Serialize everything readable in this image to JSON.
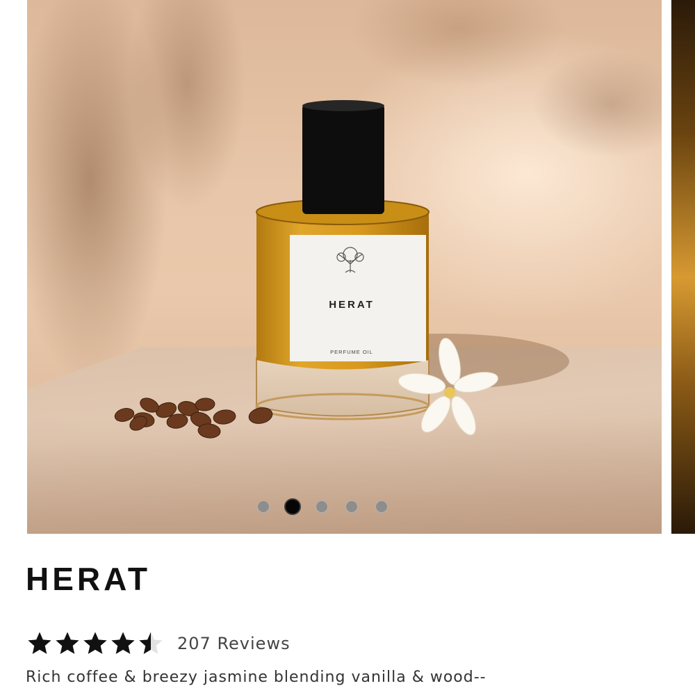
{
  "product": {
    "title": "HERAT",
    "rating_value": 4.5,
    "rating_max": 5,
    "reviews_label": "207 Reviews",
    "description": "Rich coffee & breezy jasmine blending vanilla & wood--"
  },
  "image": {
    "label_name": "HERAT",
    "label_subtitle": "PERFUME OIL",
    "icon": "tree-logo-icon"
  },
  "carousel": {
    "slide_count": 5,
    "active_index": 1
  },
  "colors": {
    "dot_active": "#050505",
    "dot_inactive": "#8d8d8d",
    "perfume_oil": "#d39a1f"
  }
}
